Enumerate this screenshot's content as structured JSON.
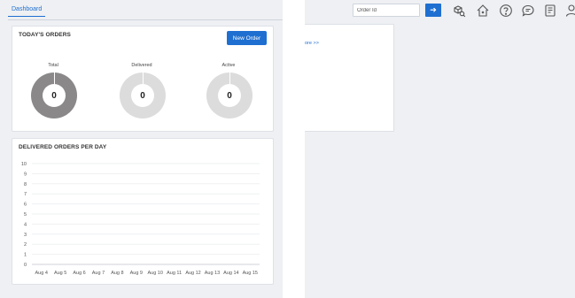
{
  "tabs": [
    {
      "label": "Dashboard"
    }
  ],
  "orders": {
    "title": "TODAY'S ORDERS",
    "new_order_label": "New Order",
    "donuts": [
      {
        "label": "Total",
        "value": "0",
        "color": "#8a8888"
      },
      {
        "label": "Delivered",
        "value": "0",
        "color": "#dcdcdc"
      },
      {
        "label": "Active",
        "value": "0",
        "color": "#dcdcdc"
      }
    ]
  },
  "popover": {
    "more_link": "ore >>"
  },
  "search": {
    "placeholder": "Order Id"
  },
  "topbar_icons": [
    "package-search-icon",
    "home-delivery-icon",
    "help-icon",
    "chat-icon",
    "report-icon",
    "user-icon"
  ],
  "chart_data": {
    "type": "line",
    "title": "DELIVERED ORDERS PER DAY",
    "categories": [
      "Aug 4",
      "Aug 5",
      "Aug 6",
      "Aug 7",
      "Aug 8",
      "Aug 9",
      "Aug 10",
      "Aug 11",
      "Aug 12",
      "Aug 13",
      "Aug 14",
      "Aug 15"
    ],
    "values": [
      0,
      0,
      0,
      0,
      0,
      0,
      0,
      0,
      0,
      0,
      0,
      0
    ],
    "y_ticks": [
      "0",
      "1",
      "2",
      "3",
      "4",
      "5",
      "6",
      "7",
      "8",
      "9",
      "10"
    ],
    "ylim": [
      0,
      10
    ],
    "grid": true
  }
}
